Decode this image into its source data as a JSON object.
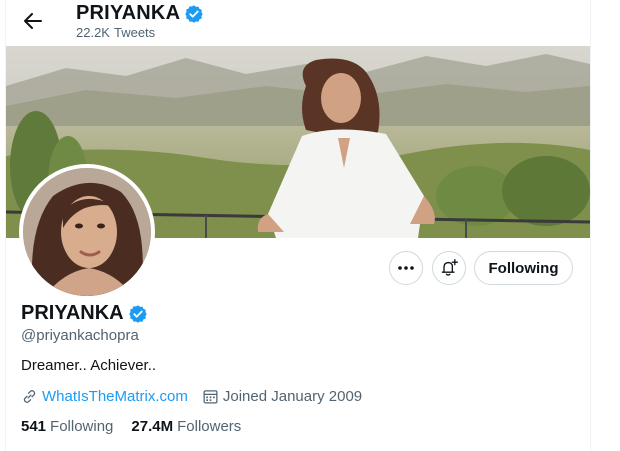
{
  "header": {
    "name": "PRIYANKA",
    "tweets_count": "22.2K",
    "tweets_label": "Tweets"
  },
  "profile": {
    "name": "PRIYANKA",
    "handle": "@priyankachopra",
    "bio": "Dreamer.. Achiever..",
    "website": "WhatIsTheMatrix.com",
    "joined": "Joined January 2009",
    "following_count": "541",
    "following_label": "Following",
    "followers_count": "27.4M",
    "followers_label": "Followers"
  },
  "actions": {
    "follow_state_label": "Following"
  },
  "icons": {
    "back": "arrow-left-icon",
    "verified": "verified-badge-icon",
    "more": "more-dots-icon",
    "notify": "bell-plus-icon",
    "link": "link-icon",
    "calendar": "calendar-icon"
  },
  "colors": {
    "accent": "#1d9bf0",
    "text": "#0f1419",
    "muted": "#536471",
    "border": "#cfd9de"
  }
}
